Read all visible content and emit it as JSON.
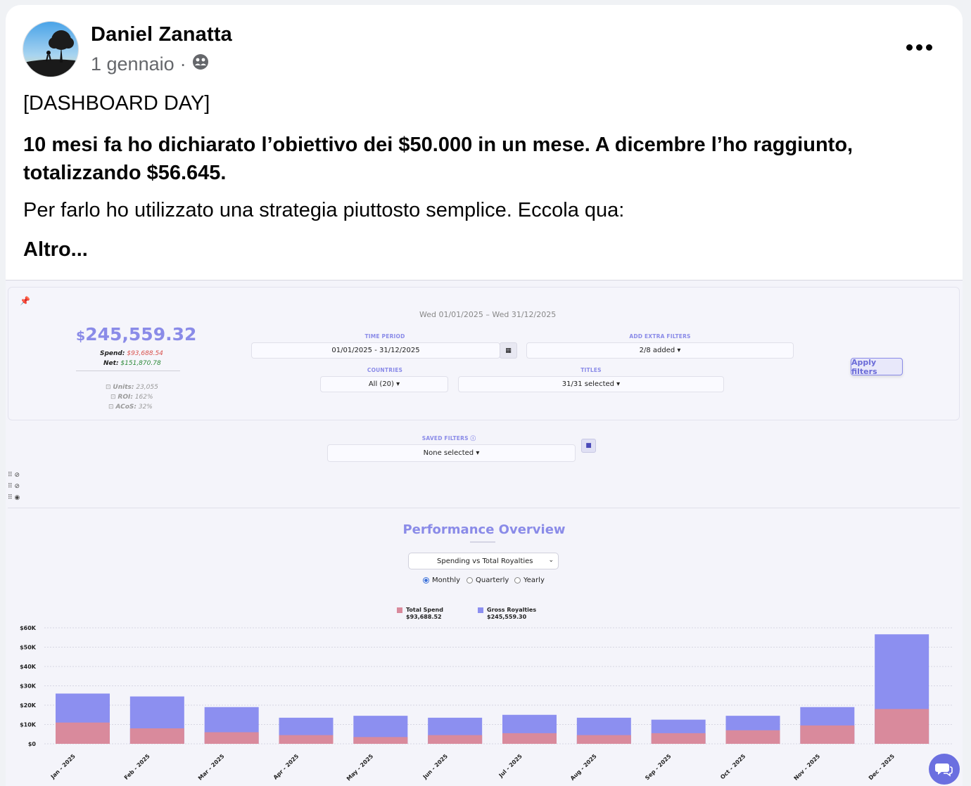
{
  "post": {
    "author": "Daniel Zanatta",
    "date": "1 gennaio",
    "separator": "·",
    "privacy_icon": "friends-icon",
    "paragraph1": "[DASHBOARD DAY]",
    "paragraph2": "10 mesi fa ho dichiarato l’obiettivo dei $50.000 in un mese. A dicembre l’ho raggiunto, totalizzando $56.645.",
    "paragraph3": "Per farlo ho utilizzato una strategia piuttosto semplice. Eccola qua:",
    "more_link": "Altro..."
  },
  "dashboard": {
    "total_currency": "$",
    "total_value": "245,559.32",
    "spend_label": "Spend:",
    "spend_value": "$93,688.54",
    "net_label": "Net:",
    "net_value": "$151,870.78",
    "units_label": "Units:",
    "units_value": "23,055",
    "roi_label": "ROI:",
    "roi_value": "162%",
    "acos_label": "ACoS:",
    "acos_value": "32%",
    "date_range": "Wed 01/01/2025 – Wed 31/12/2025",
    "time_period_label": "TIME PERIOD",
    "time_period_value": "01/01/2025 - 31/12/2025",
    "extra_filters_label": "ADD EXTRA FILTERS",
    "extra_filters_value": "2/8 added ▾",
    "countries_label": "COUNTRIES",
    "countries_value": "All (20) ▾",
    "titles_label": "TITLES",
    "titles_value": "31/31 selected ▾",
    "apply_label": "Apply filters",
    "saved_filters_label": "SAVED FILTERS",
    "saved_filters_value": "None selected ▾",
    "perf_title": "Performance Overview",
    "select_value": "Spending vs Total Royalties",
    "radio_monthly": "Monthly",
    "radio_quarterly": "Quarterly",
    "radio_yearly": "Yearly",
    "colors": {
      "accent": "#8a8be8",
      "spend": "#d98a9c",
      "royalties": "#8c8ff0"
    }
  },
  "chart_data": {
    "type": "bar",
    "stacked": true,
    "categories": [
      "Jan - 2025",
      "Feb - 2025",
      "Mar - 2025",
      "Apr - 2025",
      "May - 2025",
      "Jun - 2025",
      "Jul - 2025",
      "Aug - 2025",
      "Sep - 2025",
      "Oct - 2025",
      "Nov - 2025",
      "Dec - 2025"
    ],
    "series": [
      {
        "name": "Total Spend",
        "legend_value": "$93,688.52",
        "color": "#d98a9c",
        "values": [
          11000,
          8000,
          6000,
          4500,
          3500,
          4500,
          5500,
          4500,
          5500,
          7000,
          9500,
          18000
        ]
      },
      {
        "name": "Gross Royalties",
        "legend_value": "$245,559.30",
        "color": "#8c8ff0",
        "values": [
          26000,
          24500,
          19000,
          13500,
          14500,
          13500,
          15000,
          13500,
          12500,
          14500,
          19000,
          56645
        ]
      }
    ],
    "ytick_labels": [
      "$0",
      "$10K",
      "$20K",
      "$30K",
      "$40K",
      "$50K",
      "$60K"
    ],
    "ylim": [
      0,
      60000
    ],
    "grid": true,
    "legend_position": "top"
  }
}
